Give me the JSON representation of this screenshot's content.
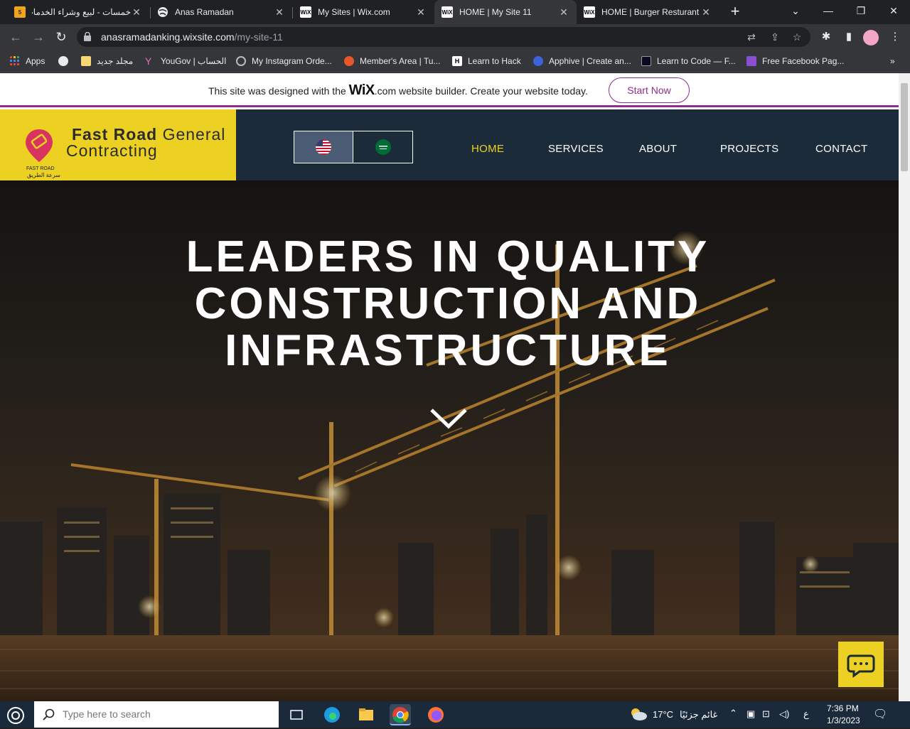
{
  "browser": {
    "tabs": [
      {
        "title": "خمسات - لبيع وشراء الخدمات",
        "favicon": "khamsat-icon",
        "favicon_text": "5",
        "favicon_color": "#f2a51a"
      },
      {
        "title": "Anas Ramadan",
        "favicon": "globe-icon"
      },
      {
        "title": "My Sites | Wix.com",
        "favicon": "wix-icon",
        "favicon_text": "WiX"
      },
      {
        "title": "HOME | My Site 11",
        "favicon": "wix-icon",
        "favicon_text": "WiX",
        "active": true
      },
      {
        "title": "HOME | Burger Resturant",
        "favicon": "wix-icon",
        "favicon_text": "WiX"
      }
    ],
    "new_tab": "+",
    "url_domain": "anasramadanking.wixsite.com",
    "url_path": "/my-site-11",
    "bookmarks": [
      {
        "label": "Apps",
        "icon": "apps-grid-icon"
      },
      {
        "label": "",
        "icon": "globe-icon"
      },
      {
        "label": "مجلد جديد",
        "icon": "folder-icon"
      },
      {
        "label": "YouGov | الحساب",
        "icon": "yougov-icon"
      },
      {
        "label": "My Instagram Orde...",
        "icon": "instagram-orders-icon"
      },
      {
        "label": "Member's Area | Tu...",
        "icon": "members-area-icon"
      },
      {
        "label": "Learn to Hack",
        "icon": "hackerone-icon"
      },
      {
        "label": "Apphive | Create an...",
        "icon": "apphive-icon"
      },
      {
        "label": "Learn to Code — F...",
        "icon": "freecodecamp-icon"
      },
      {
        "label": "Free Facebook Pag...",
        "icon": "heart-icon"
      }
    ],
    "more_bookmarks": "»"
  },
  "wix_banner": {
    "prefix": "This site was designed with the ",
    "brand": "WiX",
    "suffix": ".com website builder. Create your website today.",
    "button": "Start Now",
    "accent": "#8b2e8c"
  },
  "site": {
    "logo": {
      "name_strong": "Fast Road",
      "name_rest": " General",
      "line2": "Contracting",
      "sub_en": "FAST ROAD",
      "sub_ar": "سرعة الطريق"
    },
    "languages": [
      "English",
      "العربية"
    ],
    "menu": [
      {
        "label": "HOME",
        "active": true
      },
      {
        "label": "SERVICES"
      },
      {
        "label": "ABOUT"
      },
      {
        "label": "PROJECTS"
      },
      {
        "label": "CONTACT"
      }
    ],
    "hero": {
      "line1": "LEADERS IN QUALITY",
      "line2": "CONSTRUCTION AND",
      "line3": "INFRASTRUCTURE"
    },
    "colors": {
      "header_bg": "#1c2b3a",
      "logo_bg": "#ecd122",
      "menu_active": "#ecd122"
    }
  },
  "taskbar": {
    "search_placeholder": "Type here to search",
    "weather": "17°C",
    "weather_desc": "غائم جزئيًا",
    "lang_indicator": "ع",
    "time": "7:36 PM",
    "date": "1/3/2023"
  }
}
